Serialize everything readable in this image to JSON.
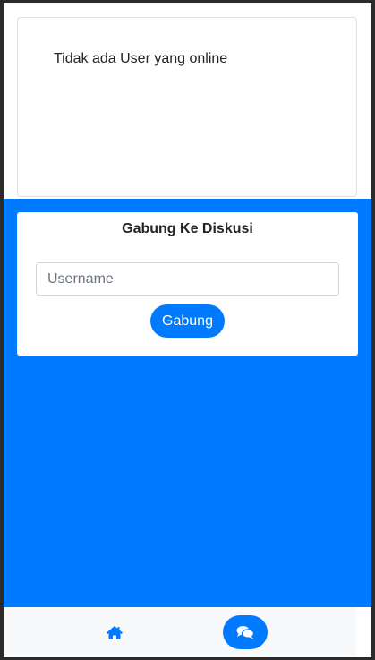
{
  "online_panel": {
    "message": "Tidak ada User yang online"
  },
  "join_panel": {
    "title": "Gabung Ke Diskusi",
    "username_placeholder": "Username",
    "username_value": "",
    "join_button_label": "Gabung"
  },
  "bottom_nav": {
    "items": [
      {
        "icon": "home-icon",
        "active": false
      },
      {
        "icon": "comments-icon",
        "active": true
      }
    ]
  },
  "colors": {
    "primary": "#007bff",
    "nav_background": "#f8f9fa",
    "text": "#212529"
  }
}
